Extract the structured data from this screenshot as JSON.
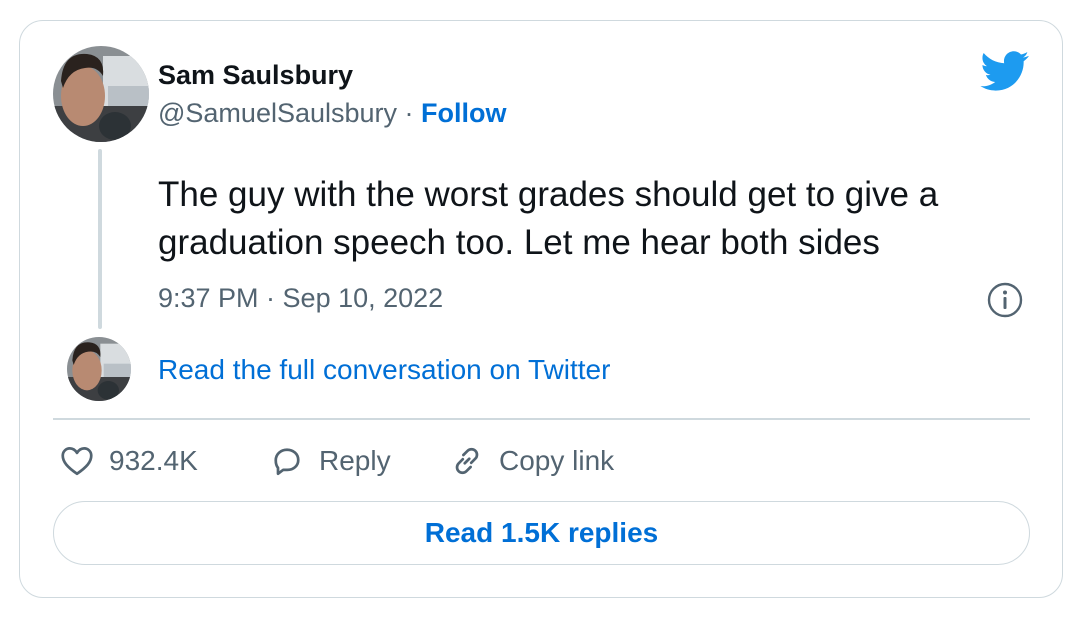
{
  "author": {
    "name": "Sam Saulsbury",
    "handle": "@SamuelSaulsbury",
    "separator": "·",
    "follow_label": "Follow"
  },
  "tweet": {
    "text": "The guy with the worst grades should get to give a graduation speech too. Let me hear both sides",
    "time": "9:37 PM · Sep 10, 2022"
  },
  "conversation_link": "Read the full conversation on Twitter",
  "actions": {
    "likes": "932.4K",
    "reply_label": "Reply",
    "copy_link_label": "Copy link"
  },
  "read_replies_label": "Read 1.5K replies",
  "icons": {
    "brand": "twitter-bird-icon",
    "info": "info-icon",
    "like": "heart-icon",
    "reply": "speech-bubble-icon",
    "copy": "link-icon"
  },
  "colors": {
    "link": "#006fd6",
    "brand": "#1d9bf0",
    "secondary_text": "#536471",
    "border": "#cfd9de"
  }
}
